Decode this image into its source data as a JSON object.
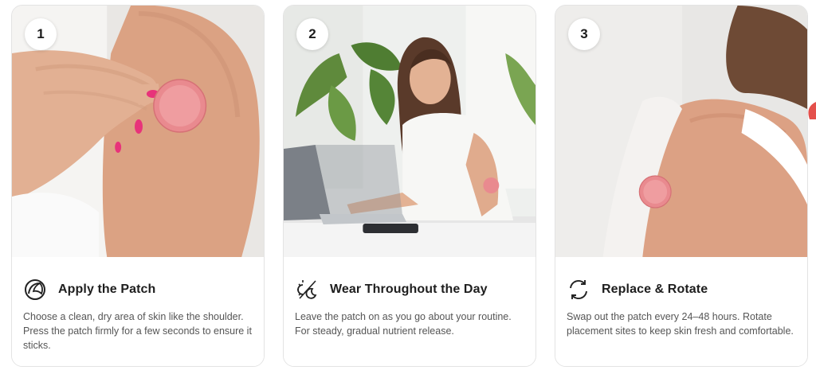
{
  "cards": [
    {
      "step": "1",
      "title": "Apply the Patch",
      "description": "Choose a clean, dry area of skin like the shoulder. Press the patch firmly for a few seconds to ensure it sticks.",
      "icon": "patch-icon",
      "photo": "hand-applying-patch-photo"
    },
    {
      "step": "2",
      "title": "Wear Throughout the Day",
      "description": "Leave the patch on as you go about your routine. For steady, gradual nutrient release.",
      "icon": "sun-moon-icon",
      "photo": "woman-at-laptop-photo"
    },
    {
      "step": "3",
      "title": "Replace & Rotate",
      "description": "Swap out the patch every 24–48 hours. Rotate placement sites to keep skin fresh and comfortable.",
      "icon": "rotate-arrows-icon",
      "photo": "patch-on-shoulder-photo"
    }
  ],
  "colors": {
    "patch": "#e98a8f",
    "nail": "#e8337a",
    "skin": "#e2ad8e",
    "border": "#e3e3e3"
  }
}
